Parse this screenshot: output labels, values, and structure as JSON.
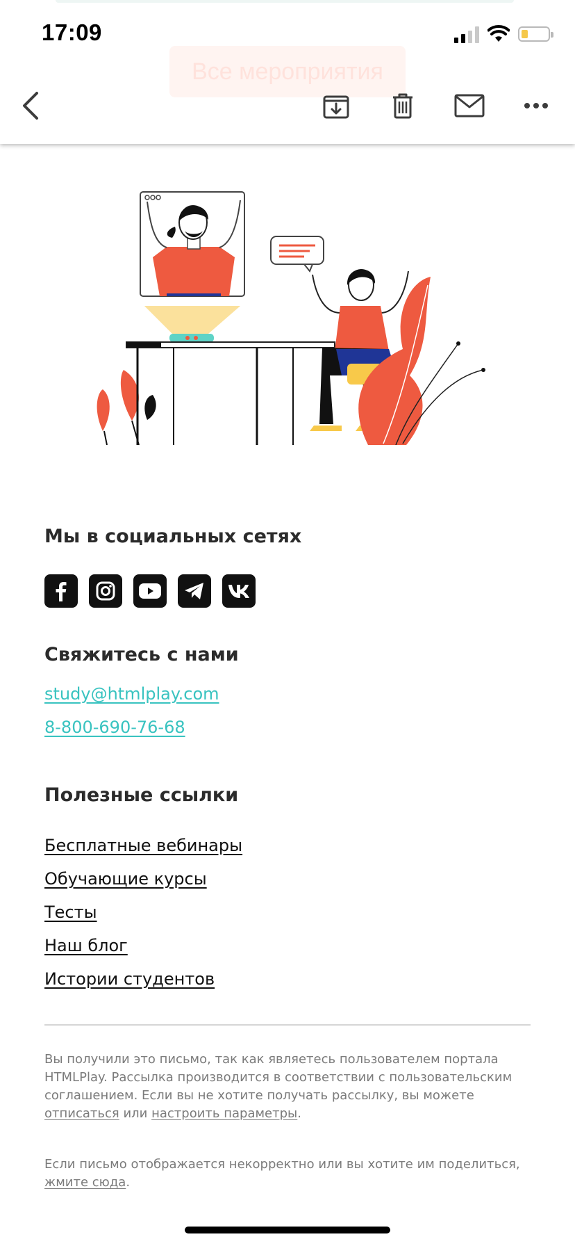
{
  "status_bar": {
    "time": "17:09",
    "icons": [
      "cellular-signal-icon",
      "wifi-icon",
      "battery-icon"
    ],
    "battery_level": 0.25
  },
  "behind_header": {
    "button_label": "Все мероприятия"
  },
  "toolbar": {
    "icons": [
      "back-chevron-icon",
      "archive-icon",
      "trash-icon",
      "mail-icon",
      "more-icon"
    ]
  },
  "social": {
    "title": "Мы в социальных сетях",
    "icons": [
      "facebook-icon",
      "instagram-icon",
      "youtube-icon",
      "telegram-icon",
      "vk-icon"
    ]
  },
  "contact": {
    "title": "Свяжитесь с нами",
    "email": "study@htmlplay.com",
    "phone": "8-800-690-76-68"
  },
  "links": {
    "title": "Полезные ссылки",
    "items": [
      "Бесплатные вебинары",
      "Обучающие курсы",
      "Тесты",
      "Наш блог",
      "Истории студентов"
    ]
  },
  "footer": {
    "notice_text": "Вы получили это письмо, так как являетесь пользователем портала HTMLPlay. Рассылка производится в соответствии с пользовательским соглашением. Если вы не хотите получать рассылку, вы можете",
    "unsubscribe_label": "отписаться",
    "or_text": "или",
    "settings_label": "настроить параметры",
    "period": ".",
    "share_text": "Если письмо отображается некорректно или вы хотите им поделиться,",
    "click_here_label": "жмите сюда"
  },
  "colors": {
    "accent_link": "#39c3c0",
    "illustration_red": "#ee5a40",
    "illustration_yellow": "#f8c94a",
    "illustration_blue": "#1f3596"
  }
}
